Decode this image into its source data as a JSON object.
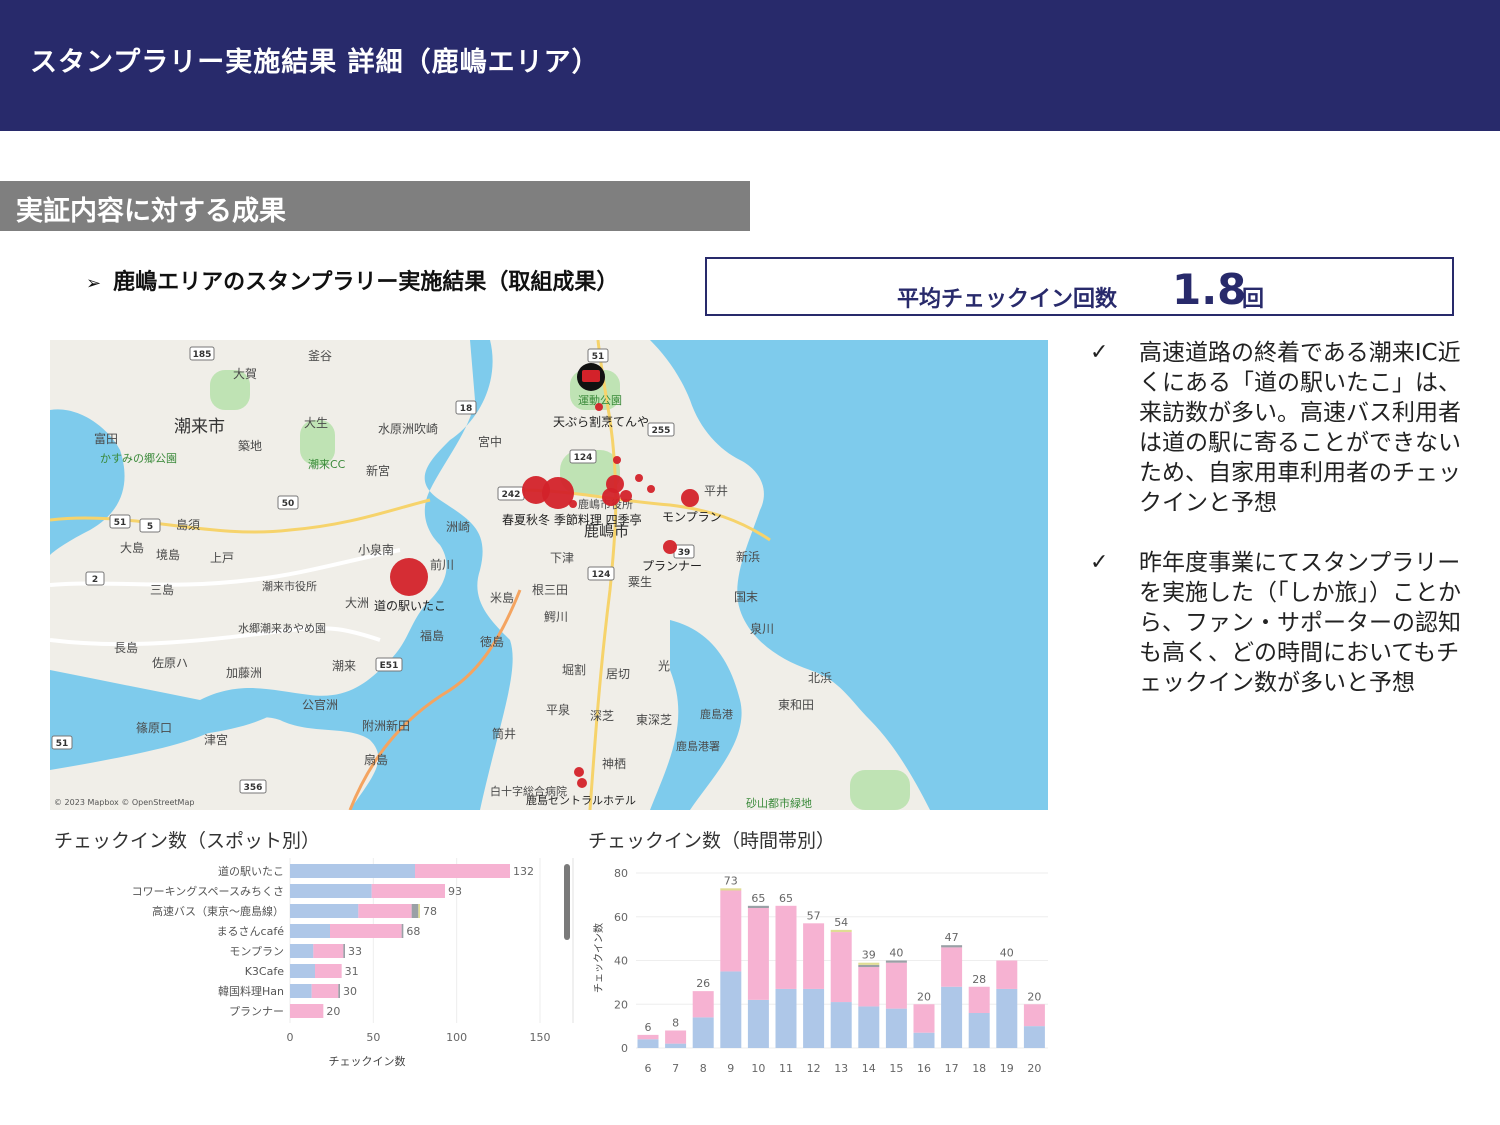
{
  "header": {
    "title": "スタンプラリー実施結果 詳細（鹿嶋エリア）"
  },
  "section": {
    "title": "実証内容に対する成果"
  },
  "subheading": {
    "bullet": "➢",
    "text": "鹿嶋エリアのスタンプラリー実施結果（取組成果）"
  },
  "kpi": {
    "label": "平均チェックイン回数",
    "value": "1.8",
    "unit": "回"
  },
  "notes": [
    {
      "check": "✓",
      "text": "高速道路の終着である潮来IC近くにある「道の駅いたこ」は、来訪数が多い。高速バス利用者は道の駅に寄ることができないため、自家用車利用者のチェックインと予想"
    },
    {
      "check": "✓",
      "text": "昨年度事業にてスタンプラリーを実施した（「しか旅」）ことから、ファン・サポーターの認知も高く、どの時間においてもチェックイン数が多いと予想"
    }
  ],
  "map": {
    "labels": {
      "shiomi": "潮来市",
      "kashima": "鹿嶋市",
      "ohga": "大賀",
      "kamagaya": "釜谷",
      "tomita": "富田",
      "kasumi": "かすみの郷公園",
      "tsukiji": "築地",
      "ousei": "大生",
      "itakocc": "潮来CC",
      "suigenshu": "水原洲吹崎",
      "shinmiya": "新宮",
      "miyanaka": "宮中",
      "tempura": "天ぷら割烹てんや",
      "undokoen": "運動公園",
      "haruka": "春夏秋冬 季節料理 四季亭",
      "monpuran": "モンプラン",
      "hirai": "平井",
      "shikataiko": "鹿嶋市役所",
      "planner": "プランナー",
      "michieki": "道の駅いたこ",
      "maekawa": "前川",
      "koizumi": "小泉南",
      "itakocityhall": "潮来市役所",
      "sunosaki": "洲崎",
      "shimotsu": "下津",
      "nezamita": "根三田",
      "kurio": "粟生",
      "kunimatsu": "国末",
      "shinhama": "新浜",
      "izumigawa": "泉川",
      "yoneshima": "米島",
      "fukushima": "福島",
      "tokushima": "徳島",
      "ohshima": "大洲",
      "hirohashi": "鰐川",
      "hori": "堀割",
      "idokiri": "居切",
      "hikari": "光",
      "kitahama": "北浜",
      "higashiwada": "東和田",
      "kashimako": "鹿島港",
      "kashimasho": "鹿島港署",
      "higashifukashiba": "東深芝",
      "fukashiba": "深芝",
      "hiraizumi": "平泉",
      "tsutsui": "筒井",
      "kamisu": "神栖",
      "kashimacentral": "鹿島セントラルホテル",
      "jujigaku": "白十字総合病院",
      "sunayama": "砂山都市緑地",
      "shinohara": "篠原口",
      "tsumiya": "津宮",
      "fujishima": "加藤洲",
      "sahara": "佐原ハ",
      "nagashima": "長島",
      "mishima": "三島",
      "ohshimaW": "大島",
      "sakaijima": "境島",
      "kamito": "上戸",
      "shimasu": "島須",
      "itakohiryu": "潮来",
      "hashiuchi": "公官洲",
      "fukiyoshi": "附洲新田",
      "sakakura": "扇島",
      "suigo": "水郷潮来あやめ園",
      "copyright": "© 2023 Mapbox © OpenStreetMap",
      "r185": "185",
      "r51": "51",
      "r18": "18",
      "r255": "255",
      "r124": "124",
      "r242": "242",
      "r50": "50",
      "r5": "5",
      "r2": "2",
      "r124b": "124",
      "r39": "39",
      "rE51": "E51",
      "r51b": "51",
      "r356": "356",
      "r51c": "51"
    }
  },
  "chart_data": [
    {
      "type": "bar",
      "orientation": "horizontal",
      "stacked": true,
      "title": "チェックイン数（スポット別）",
      "xlabel": "チェックイン数",
      "ylabel": "",
      "xlim": [
        0,
        150
      ],
      "xticks": [
        "0",
        "50",
        "100",
        "150"
      ],
      "categories": [
        "道の駅いたこ",
        "コワーキングスペースみちくさ",
        "高速バス（東京～鹿島線）",
        "まるさんcafé",
        "モンプラン",
        "K3Cafe",
        "韓国料理Han",
        "プランナー"
      ],
      "totals": [
        132,
        93,
        78,
        68,
        33,
        31,
        30,
        20
      ],
      "series": [
        {
          "color": "#aec7e8",
          "values": [
            75,
            49,
            41,
            24,
            14,
            15,
            13,
            0
          ]
        },
        {
          "color": "#f6b2d2",
          "values": [
            57,
            44,
            32,
            43,
            18,
            16,
            16,
            20
          ]
        },
        {
          "color": "#9aa0a6",
          "values": [
            0,
            0,
            4,
            1,
            1,
            0,
            1,
            0
          ]
        },
        {
          "color": "#e0dc94",
          "values": [
            0,
            0,
            1,
            0,
            0,
            0,
            0,
            0
          ]
        }
      ]
    },
    {
      "type": "bar",
      "orientation": "vertical",
      "stacked": true,
      "title": "チェックイン数（時間帯別）",
      "xlabel": "",
      "ylabel": "チェックイン数",
      "ylim": [
        0,
        80
      ],
      "yticks": [
        "0",
        "20",
        "40",
        "60",
        "80"
      ],
      "categories": [
        "6",
        "7",
        "8",
        "9",
        "10",
        "11",
        "12",
        "13",
        "14",
        "15",
        "16",
        "17",
        "18",
        "19",
        "20"
      ],
      "totals": [
        6,
        8,
        26,
        73,
        65,
        65,
        57,
        54,
        39,
        40,
        20,
        47,
        28,
        40,
        20
      ],
      "series": [
        {
          "color": "#aec7e8",
          "values": [
            4,
            2,
            14,
            35,
            22,
            27,
            27,
            21,
            19,
            18,
            7,
            28,
            16,
            27,
            10
          ]
        },
        {
          "color": "#f6b2d2",
          "values": [
            2,
            6,
            12,
            37,
            42,
            38,
            30,
            32,
            18,
            21,
            13,
            18,
            12,
            13,
            10
          ]
        },
        {
          "color": "#9aa0a6",
          "values": [
            0,
            0,
            0,
            0,
            1,
            0,
            0,
            0,
            1,
            1,
            0,
            1,
            0,
            0,
            0
          ]
        },
        {
          "color": "#e0dc94",
          "values": [
            0,
            0,
            0,
            1,
            0,
            0,
            0,
            1,
            1,
            0,
            0,
            0,
            0,
            0,
            0
          ]
        }
      ]
    }
  ]
}
